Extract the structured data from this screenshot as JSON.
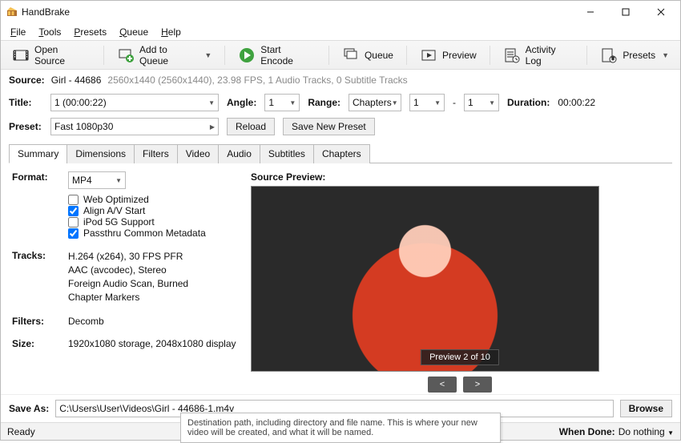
{
  "window": {
    "title": "HandBrake"
  },
  "menu": {
    "file": "File",
    "tools": "Tools",
    "presets": "Presets",
    "queue": "Queue",
    "help": "Help"
  },
  "toolbar": {
    "open_source": "Open Source",
    "add_to_queue": "Add to Queue",
    "start_encode": "Start Encode",
    "queue": "Queue",
    "preview": "Preview",
    "activity_log": "Activity Log",
    "presets": "Presets"
  },
  "source": {
    "label": "Source:",
    "name": "Girl - 44686",
    "details": "2560x1440 (2560x1440), 23.98 FPS, 1 Audio Tracks, 0 Subtitle Tracks"
  },
  "title_row": {
    "title_label": "Title:",
    "title_value": "1  (00:00:22)",
    "angle_label": "Angle:",
    "angle_value": "1",
    "range_label": "Range:",
    "range_type": "Chapters",
    "range_from": "1",
    "range_sep": "-",
    "range_to": "1",
    "duration_label": "Duration:",
    "duration_value": "00:00:22"
  },
  "preset_row": {
    "label": "Preset:",
    "value": "Fast 1080p30",
    "reload": "Reload",
    "save_new": "Save New Preset"
  },
  "tabs": [
    "Summary",
    "Dimensions",
    "Filters",
    "Video",
    "Audio",
    "Subtitles",
    "Chapters"
  ],
  "summary": {
    "format_label": "Format:",
    "format_value": "MP4",
    "web_optimized": "Web Optimized",
    "align_av": "Align A/V Start",
    "ipod": "iPod 5G Support",
    "passthru": "Passthru Common Metadata",
    "tracks_label": "Tracks:",
    "tracks": [
      "H.264 (x264), 30 FPS PFR",
      "AAC (avcodec), Stereo",
      "Foreign Audio Scan, Burned",
      "Chapter Markers"
    ],
    "filters_label": "Filters:",
    "filters_value": "Decomb",
    "size_label": "Size:",
    "size_value": "1920x1080 storage, 2048x1080 display",
    "preview_label": "Source Preview:",
    "preview_badge": "Preview 2 of 10",
    "prev": "<",
    "next": ">"
  },
  "saveas": {
    "label": "Save As:",
    "value": "C:\\Users\\User\\Videos\\Girl - 44686-1.m4v",
    "browse": "Browse",
    "tooltip": "Destination path, including directory and file name. This is where your new video will be created, and what it will be named."
  },
  "status": {
    "ready": "Ready",
    "when_done_label": "When Done:",
    "when_done_value": "Do nothing"
  }
}
